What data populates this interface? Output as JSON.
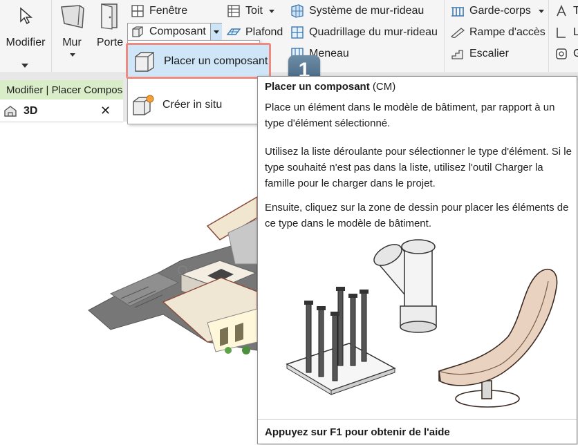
{
  "ribbon": {
    "modifier": {
      "label": "Modifier"
    },
    "mur": {
      "label": "Mur"
    },
    "porte": {
      "label": "Porte"
    },
    "fenetre": {
      "label": "Fenêtre"
    },
    "composant": {
      "label": "Composant"
    },
    "toit": {
      "label": "Toit"
    },
    "plafond": {
      "label": "Plafond"
    },
    "systeme_mur_rideau": {
      "label": "Système de mur-rideau"
    },
    "quadrillage_mur_rideau": {
      "label": "Quadrillage du mur-rideau"
    },
    "meneau": {
      "label": "Meneau"
    },
    "garde_corps": {
      "label": "Garde-corps"
    },
    "rampe_acces": {
      "label": "Rampe d'accès"
    },
    "escalier": {
      "label": "Escalier"
    },
    "cut_items": [
      "T",
      "L",
      "G"
    ]
  },
  "context_bar": {
    "text": "Modifier | Placer Composant"
  },
  "view_tab": {
    "label": "3D",
    "close": "✕"
  },
  "dropdown": {
    "items": [
      {
        "label": "Placer un composant",
        "icon": "place-component-icon"
      },
      {
        "label": "Créer in situ",
        "icon": "create-in-place-icon"
      }
    ]
  },
  "callout": {
    "number": "1"
  },
  "tooltip": {
    "title": "Placer un composant",
    "shortcut": " (CM)",
    "paragraphs": [
      "Place un élément dans le modèle de bâtiment, par rapport à un type d'élément sélectionné.",
      "Utilisez la liste déroulante pour sélectionner le type d'élément. Si le type souhaité n'est pas dans la liste, utilisez l'outil Charger la famille pour le charger dans le projet.",
      "Ensuite, cliquez sur la zone de dessin pour placer les éléments de ce type dans le modèle de bâtiment."
    ],
    "footer": "Appuyez sur F1 pour obtenir de l'aide"
  },
  "colors": {
    "highlight_border": "#ee8a7f",
    "context_bar": "#d9edc8",
    "badge": "#4f6f8b"
  }
}
